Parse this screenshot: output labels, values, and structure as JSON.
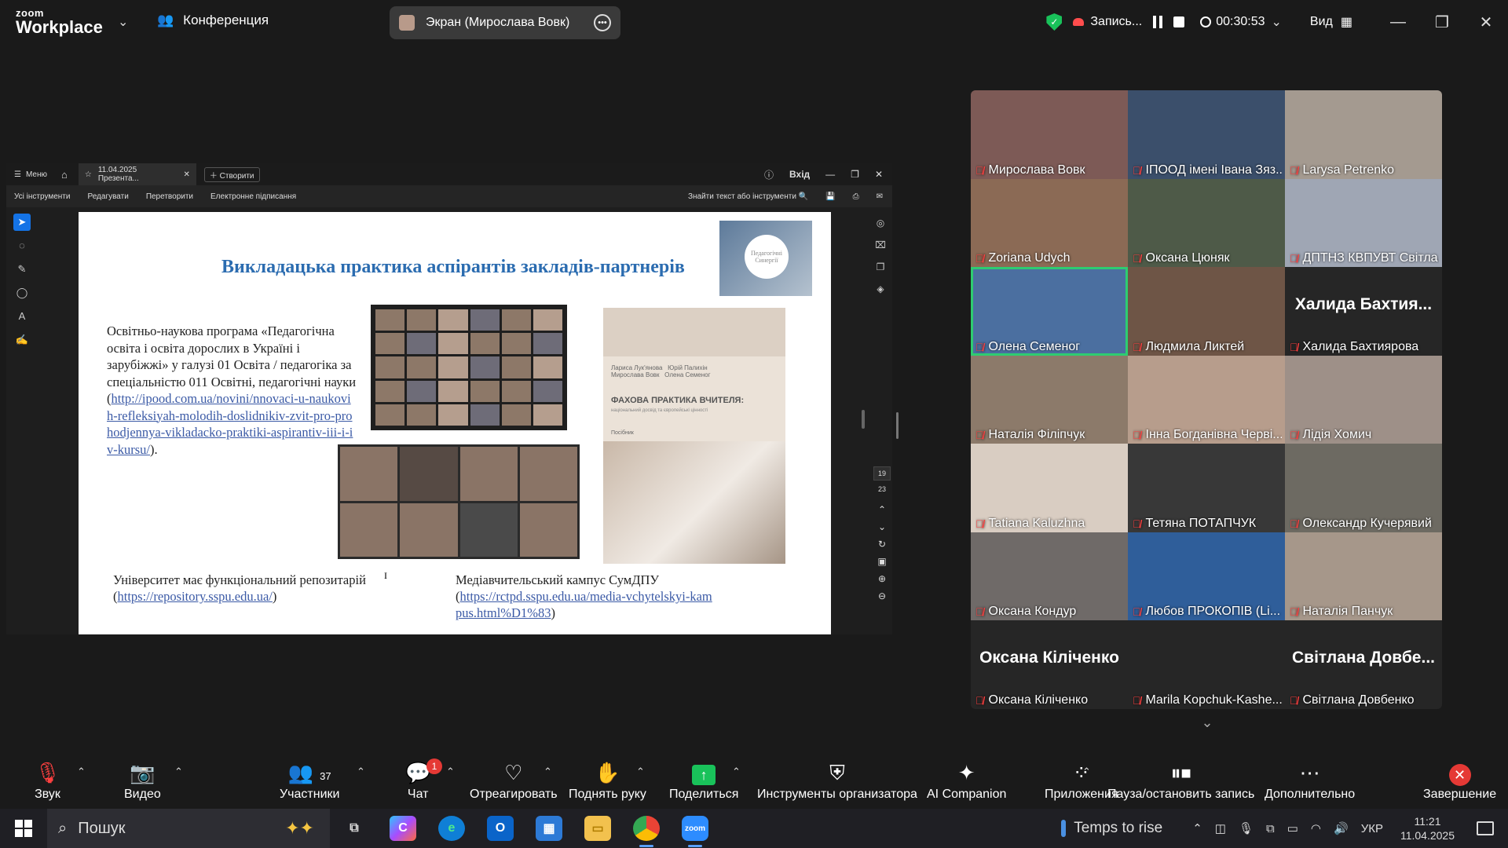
{
  "app": {
    "logo_line1": "zoom",
    "logo_line2": "Workplace",
    "meeting_label": "Конференция",
    "share_label": "Экран (Мирослава Вовк)",
    "record_label": "Запись...",
    "timer": "00:30:53",
    "view_label": "Вид"
  },
  "pdf": {
    "menu_label": "Меню",
    "tab_label": "11.04.2025 Презента...",
    "create_label": "Створити",
    "login_label": "Вхід",
    "tools": [
      "Усі інструменти",
      "Редагувати",
      "Перетворити",
      "Електронне підписання"
    ],
    "find_label": "Знайти текст або інструменти",
    "page_current": "19",
    "page_total": "23"
  },
  "slide": {
    "title": "Викладацька практика  аспірантів закладів-партнерів",
    "logo_text": "Педагогічні Синергії",
    "program_text": "Освітньо-наукова програма «Педагогічна освіта і освіта дорослих в Україні і зарубіжжі» у галузі 01 Освіта / педагогіка за спеціальністю 011 Освітні, педагогічні науки (",
    "program_link": "http://ipood.com.ua/novini/nnovaci-u-naukovih-refleksiyah-molodih-doslidnikiv-zvit-pro-prohodjennya-vikladacko-praktiki-aspirantiv-iii-i-iv-kursu/",
    "program_end": ").",
    "book_authors": "Лариса Лук'янова   Юрій Палихін\nМирослава Вовк   Олена Семеног",
    "book_title": "ФАХОВА ПРАКТИКА ВЧИТЕЛЯ:",
    "book_subtitle": "національний досвід та європейські цінності",
    "book_kind": "Посібник",
    "uni_text": "Університет має функціональний репозитарій",
    "uni_link": "https://repository.sspu.edu.ua/",
    "campus_text": "Медіавчительський кампус СумДПУ",
    "campus_link": "https://rctpd.sspu.edu.ua/media-vchytelskyi-kampus.html%D1%83"
  },
  "participants": [
    {
      "name": "Мирослава Вовк",
      "big": "",
      "bg": "#7d5a56"
    },
    {
      "name": "ІПООД імені Івана Зяз...",
      "big": "",
      "bg": "#3b4f6b"
    },
    {
      "name": "Larysa Petrenko",
      "big": "",
      "bg": "#a49a90"
    },
    {
      "name": "Zoriana Udych",
      "big": "",
      "bg": "#8b6a55"
    },
    {
      "name": "Оксана Цюняк",
      "big": "",
      "bg": "#4e5a48"
    },
    {
      "name": "ДПТНЗ КВПУВТ Світла...",
      "big": "",
      "bg": "#9fa6b4"
    },
    {
      "name": "Олена Семеног",
      "big": "",
      "bg": "#4b6fa0",
      "speaking": true
    },
    {
      "name": "Людмила Ликтей",
      "big": "",
      "bg": "#6e5546"
    },
    {
      "name": "Халида Бахтиярова",
      "big": "Халида  Бахтия...",
      "bg": "#262626"
    },
    {
      "name": "Наталія Філіпчук",
      "big": "",
      "bg": "#8c7a6a"
    },
    {
      "name": "Інна Богданівна Черві...",
      "big": "",
      "bg": "#b79d8c"
    },
    {
      "name": "Лідія Хомич",
      "big": "",
      "bg": "#9e9088"
    },
    {
      "name": "Tatiana Kaluzhna",
      "big": "",
      "bg": "#d9cdc2"
    },
    {
      "name": "Тетяна ПОТАПЧУК",
      "big": "",
      "bg": "#383838"
    },
    {
      "name": "Олександр Кучерявий",
      "big": "",
      "bg": "#6d6a62"
    },
    {
      "name": "Оксана Кондур",
      "big": "",
      "bg": "#6f6a68"
    },
    {
      "name": "Любов ПРОКОПІВ (Li...",
      "big": "",
      "bg": "#2f5e9a"
    },
    {
      "name": "Наталія Панчук",
      "big": "",
      "bg": "#a6978a"
    },
    {
      "name": "Оксана Кіліченко",
      "big": "Оксана Кіліченко",
      "bg": "#262626"
    },
    {
      "name": "Marila Kopchuk-Kashe...",
      "big": "",
      "bg": "#262626"
    },
    {
      "name": "Світлана Довбенко",
      "big": "Світлана  Довбе...",
      "bg": "#262626"
    }
  ],
  "toolbar": {
    "audio": "Звук",
    "video": "Видео",
    "participants": "Участники",
    "participants_count": "37",
    "chat": "Чат",
    "chat_badge": "1",
    "react": "Отреагировать",
    "raise_hand": "Поднять руку",
    "share": "Поделиться",
    "host_tools": "Инструменты организатора",
    "ai": "AI Companion",
    "apps": "Приложения",
    "pause_rec": "Пауза/остановить запись",
    "more": "Дополнительно",
    "end": "Завершение"
  },
  "taskbar": {
    "search_placeholder": "Пошук",
    "weather": "Temps to rise",
    "lang": "УКР",
    "time": "11:21",
    "date": "11.04.2025"
  }
}
